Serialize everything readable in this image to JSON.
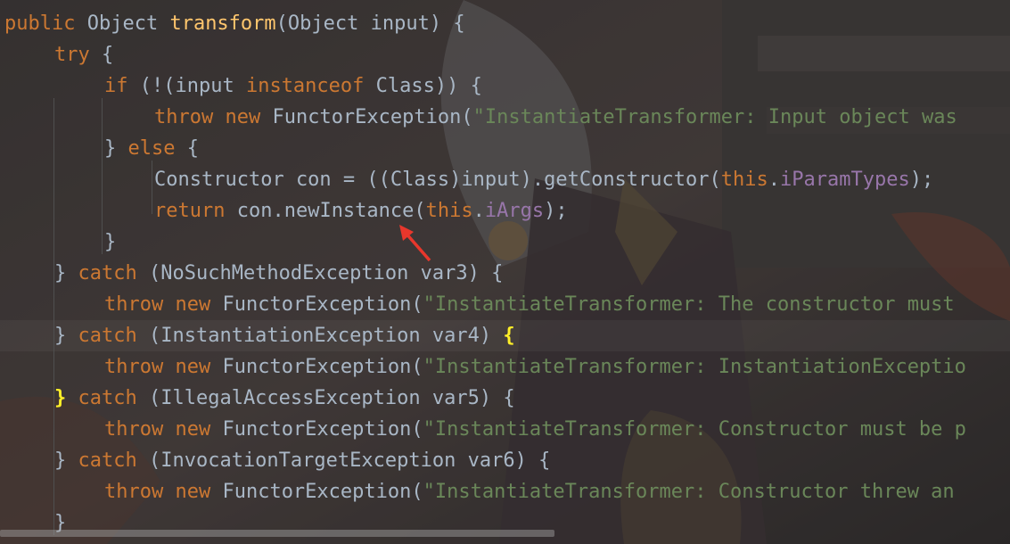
{
  "code_lines": [
    {
      "tokens": [
        {
          "t": "public",
          "c": "kw"
        },
        {
          "t": " Object ",
          "c": ""
        },
        {
          "t": "transform",
          "c": "fn"
        },
        {
          "t": "(Object input) {",
          "c": ""
        }
      ]
    },
    {
      "tokens": [
        {
          "t": "try",
          "c": "kw"
        },
        {
          "t": " {",
          "c": ""
        }
      ]
    },
    {
      "tokens": [
        {
          "t": "if",
          "c": "kw"
        },
        {
          "t": " (!(input ",
          "c": ""
        },
        {
          "t": "instanceof",
          "c": "kw"
        },
        {
          "t": " Class)) {",
          "c": ""
        }
      ]
    },
    {
      "tokens": [
        {
          "t": "throw new",
          "c": "kw"
        },
        {
          "t": " FunctorException(",
          "c": ""
        },
        {
          "t": "\"InstantiateTransformer: Input object was",
          "c": "str"
        }
      ]
    },
    {
      "tokens": [
        {
          "t": "} ",
          "c": ""
        },
        {
          "t": "else",
          "c": "kw"
        },
        {
          "t": " {",
          "c": ""
        }
      ]
    },
    {
      "tokens": [
        {
          "t": "Constructor con = ((Class)input).getConstructor(",
          "c": ""
        },
        {
          "t": "this",
          "c": "kw"
        },
        {
          "t": ".",
          "c": ""
        },
        {
          "t": "iParamTypes",
          "c": "fld"
        },
        {
          "t": ");",
          "c": ""
        }
      ]
    },
    {
      "tokens": [
        {
          "t": "return",
          "c": "kw"
        },
        {
          "t": " con.newInstance(",
          "c": ""
        },
        {
          "t": "this",
          "c": "kw"
        },
        {
          "t": ".",
          "c": ""
        },
        {
          "t": "iArgs",
          "c": "fld"
        },
        {
          "t": ");",
          "c": ""
        }
      ]
    },
    {
      "tokens": [
        {
          "t": "}",
          "c": ""
        }
      ]
    },
    {
      "tokens": [
        {
          "t": "} ",
          "c": ""
        },
        {
          "t": "catch",
          "c": "kw"
        },
        {
          "t": " (NoSuchMethodException var3) {",
          "c": ""
        }
      ]
    },
    {
      "tokens": [
        {
          "t": "throw new",
          "c": "kw"
        },
        {
          "t": " FunctorException(",
          "c": ""
        },
        {
          "t": "\"InstantiateTransformer: The constructor must",
          "c": "str"
        }
      ]
    },
    {
      "tokens": [
        {
          "t": "} ",
          "c": ""
        },
        {
          "t": "catch",
          "c": "kw"
        },
        {
          "t": " (InstantiationException var4) ",
          "c": ""
        },
        {
          "t": "{",
          "c": "brace-hl"
        }
      ]
    },
    {
      "tokens": [
        {
          "t": "throw new",
          "c": "kw"
        },
        {
          "t": " FunctorException(",
          "c": ""
        },
        {
          "t": "\"InstantiateTransformer: InstantiationExceptio",
          "c": "str"
        }
      ]
    },
    {
      "tokens": [
        {
          "t": "}",
          "c": "brace-hl"
        },
        {
          "t": " ",
          "c": ""
        },
        {
          "t": "catch",
          "c": "kw"
        },
        {
          "t": " (IllegalAccessException var5) {",
          "c": ""
        }
      ]
    },
    {
      "tokens": [
        {
          "t": "throw new",
          "c": "kw"
        },
        {
          "t": " FunctorException(",
          "c": ""
        },
        {
          "t": "\"InstantiateTransformer: Constructor must be p",
          "c": "str"
        }
      ]
    },
    {
      "tokens": [
        {
          "t": "} ",
          "c": ""
        },
        {
          "t": "catch",
          "c": "kw"
        },
        {
          "t": " (InvocationTargetException var6) {",
          "c": ""
        }
      ]
    },
    {
      "tokens": [
        {
          "t": "throw new",
          "c": "kw"
        },
        {
          "t": " FunctorException(",
          "c": ""
        },
        {
          "t": "\"InstantiateTransformer: Constructor threw an",
          "c": "str"
        }
      ]
    },
    {
      "tokens": [
        {
          "t": "}",
          "c": ""
        }
      ]
    }
  ],
  "colors": {
    "keyword": "#cc7832",
    "method": "#ffc66d",
    "string": "#6a8759",
    "field": "#9876aa",
    "default": "#a9b7c6",
    "brace_match": "#ffef28",
    "annotation_arrow": "#e8372c"
  },
  "icons": {
    "annotation": "red-arrow-icon"
  }
}
